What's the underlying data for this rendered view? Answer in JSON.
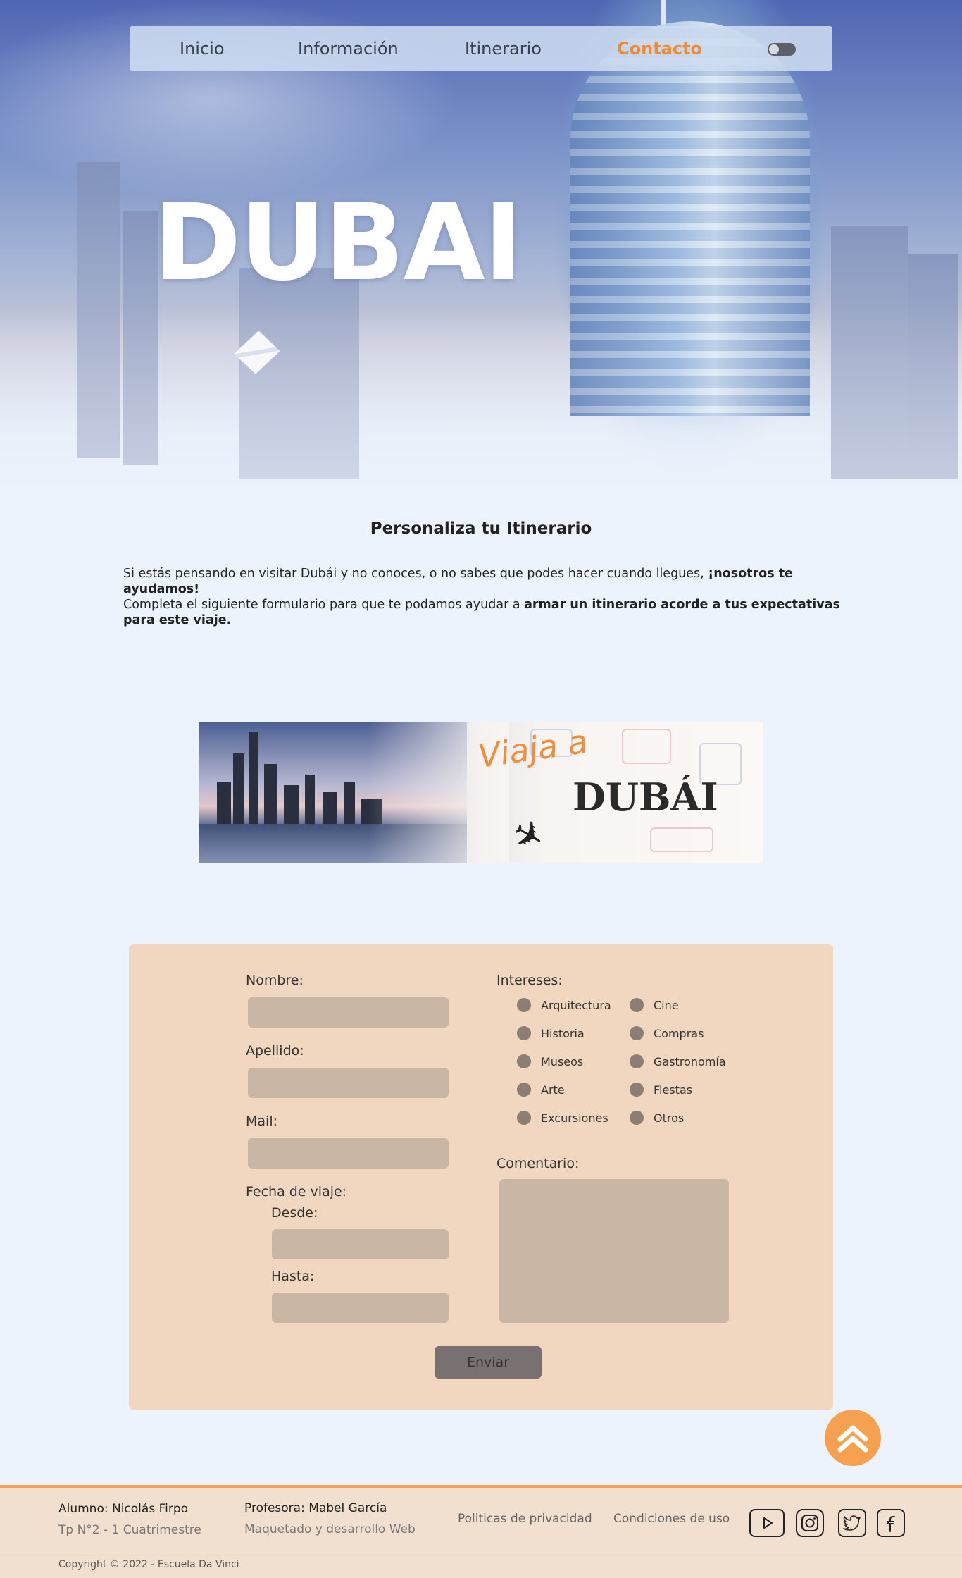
{
  "nav": {
    "items": [
      "Inicio",
      "Información",
      "Itinerario",
      "Contacto"
    ],
    "active": "Contacto",
    "accent_color": "#f28a2e"
  },
  "hero": {
    "title": "DUBAI"
  },
  "intro": {
    "title": "Personaliza tu Itinerario",
    "p1_text": "Si estás pensando en visitar Dubái y no conoces, o no sabes que podes hacer cuando llegues, ",
    "p1_bold": "¡nosotros te ayudamos!",
    "p2_text": "Completa el siguiente formulario para que te podamos ayudar a ",
    "p2_bold": "armar un itinerario acorde a tus expectativas para este viaje."
  },
  "banner": {
    "line1": "Viaja a",
    "line2": "DUBÁI"
  },
  "form": {
    "nombre_label": "Nombre:",
    "apellido_label": "Apellido:",
    "mail_label": "Mail:",
    "fecha_label": "Fecha de viaje:",
    "desde_label": "Desde:",
    "hasta_label": "Hasta:",
    "intereses_label": "Intereses:",
    "intereses": [
      "Arquitectura",
      "Cine",
      "Historia",
      "Compras",
      "Museos",
      "Gastronomía",
      "Arte",
      "Fiestas",
      "Excursiones",
      "Otros"
    ],
    "comentario_label": "Comentario:",
    "submit_label": "Enviar",
    "card_color": "#f1d7bf"
  },
  "footer": {
    "alumno": "Alumno: Nicolás Firpo",
    "tp": "Tp N°2 - 1 Cuatrimestre",
    "profesora": "Profesora: Mabel García",
    "maquetado": "Maquetado y desarrollo Web",
    "privacidad": "Politicas de privacidad",
    "condiciones": "Condiciones de uso",
    "copyright": "Copyright  ©  2022 - Escuela Da Vinci",
    "social_icons": [
      "youtube-icon",
      "instagram-icon",
      "twitter-icon",
      "facebook-icon"
    ]
  }
}
